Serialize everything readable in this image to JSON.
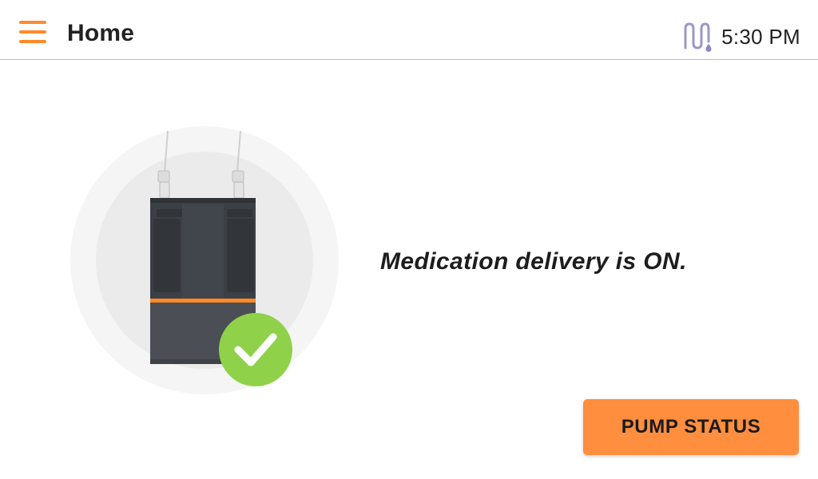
{
  "header": {
    "title": "Home",
    "menu_icon": "hamburger-menu-icon",
    "connection_icon": "tubing-connection-icon",
    "time": "5:30 PM"
  },
  "main": {
    "illustration": "insulin-pump-cartridge-with-checkmark",
    "status_message": "Medication delivery is ON.",
    "pump_status_button": "PUMP STATUS"
  },
  "colors": {
    "accent": "#ff8f3f",
    "menu_icon": "#ff8a2a",
    "check_badge": "#8fd24a",
    "connection_icon": "#9a98c9",
    "device_body": "#3b4046"
  }
}
